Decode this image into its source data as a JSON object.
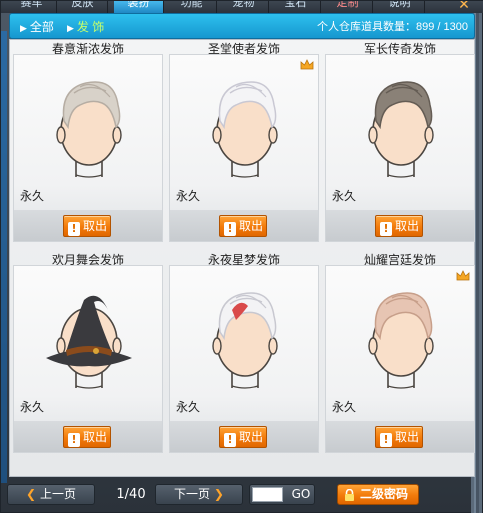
{
  "tabs": [
    {
      "label": "赛车"
    },
    {
      "label": "皮肤"
    },
    {
      "label": "装扮"
    },
    {
      "label": "功能"
    },
    {
      "label": "宠物"
    },
    {
      "label": "宝石"
    },
    {
      "label": "定制"
    },
    {
      "label": "说明"
    }
  ],
  "filters": {
    "all": "全部",
    "hair": "发 饰"
  },
  "capacity": "个人仓库道具数量：899 / 1300",
  "items": [
    {
      "name": "春意渐浓发饰",
      "duration": "永久",
      "action": "取出",
      "crown": false,
      "hair": "#d8d2c9",
      "hairShade": "#b6ada3"
    },
    {
      "name": "圣堂使者发饰",
      "duration": "永久",
      "action": "取出",
      "crown": true,
      "hair": "#f4f4f6",
      "hairShade": "#c9c8d3"
    },
    {
      "name": "军长传奇发饰",
      "duration": "永久",
      "action": "取出",
      "crown": false,
      "hair": "#8a8177",
      "hairShade": "#645c54"
    },
    {
      "name": "欢月舞会发饰",
      "duration": "永久",
      "action": "取出",
      "crown": false,
      "hair": "#3a3a3e",
      "hairShade": "#1f1f22"
    },
    {
      "name": "永夜星梦发饰",
      "duration": "永久",
      "action": "取出",
      "crown": false,
      "hair": "#f3f3f5",
      "hairShade": "#c8c8d0"
    },
    {
      "name": "灿耀宫廷发饰",
      "duration": "永久",
      "action": "取出",
      "crown": true,
      "hair": "#e7c5b3",
      "hairShade": "#c79f8a"
    }
  ],
  "pager": {
    "prev": "上一页",
    "next": "下一页",
    "page": "1/40",
    "go": "GO",
    "input_value": ""
  },
  "password_button": "二级密码",
  "icons": {
    "close": "close-icon",
    "crown": "crown-icon",
    "lock": "lock-icon",
    "exclaim": "exclamation-icon"
  },
  "colors": {
    "accent": "#1fa3dd",
    "button": "#f27a0b",
    "crown": "#f5a623"
  }
}
